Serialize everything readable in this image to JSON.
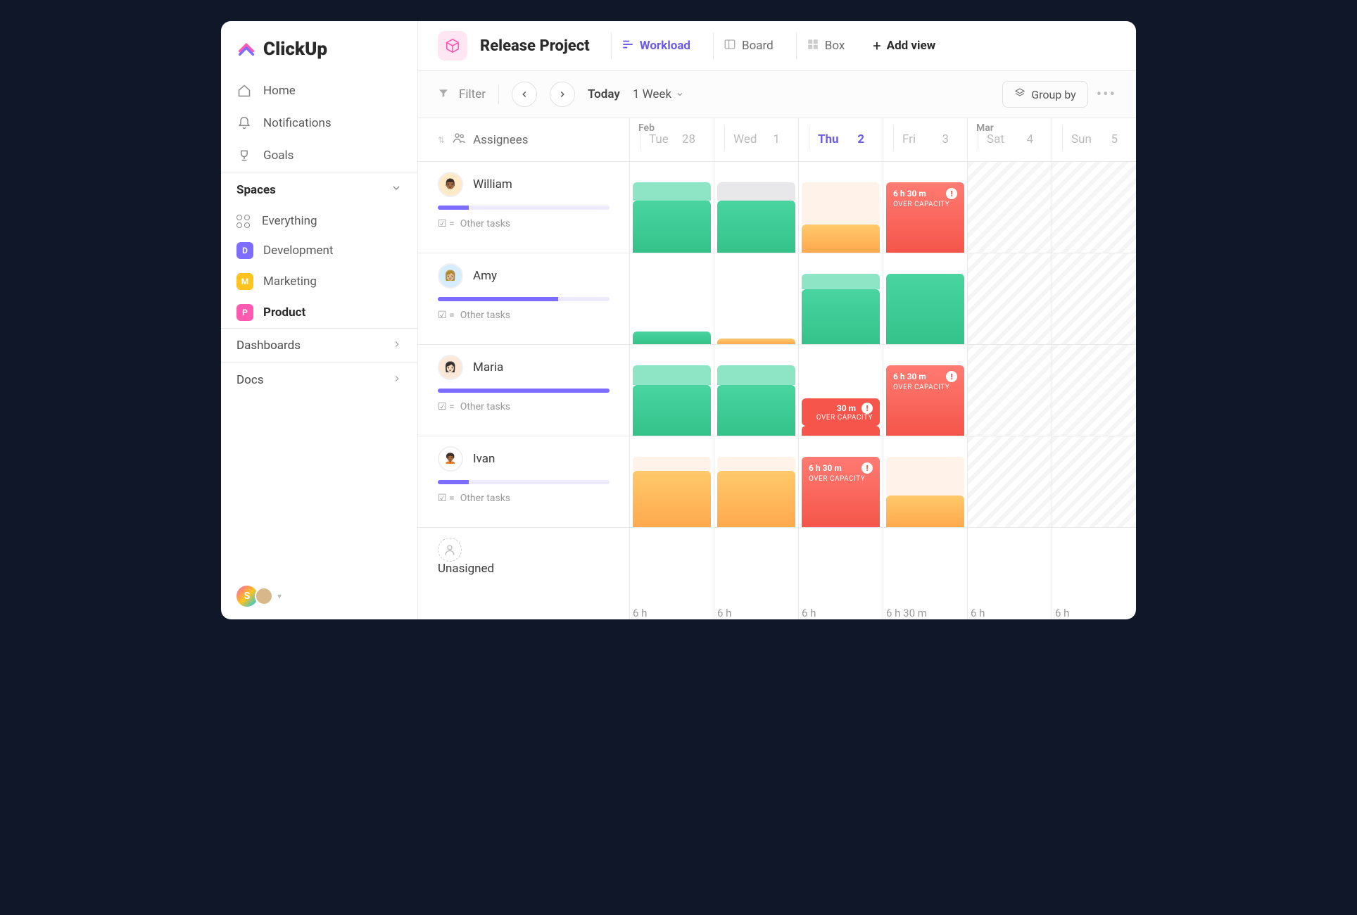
{
  "brand": "ClickUp",
  "nav": {
    "home": "Home",
    "notifications": "Notifications",
    "goals": "Goals"
  },
  "spaces_header": "Spaces",
  "spaces": {
    "everything": "Everything",
    "items": [
      {
        "letter": "D",
        "label": "Development"
      },
      {
        "letter": "M",
        "label": "Marketing"
      },
      {
        "letter": "P",
        "label": "Product"
      }
    ]
  },
  "dashboards": "Dashboards",
  "docs": "Docs",
  "project": {
    "title": "Release Project"
  },
  "views": {
    "workload": "Workload",
    "board": "Board",
    "box": "Box",
    "add": "Add view"
  },
  "toolbar": {
    "filter": "Filter",
    "today": "Today",
    "range": "1 Week",
    "group_by": "Group by"
  },
  "columns": {
    "assignees": "Assignees",
    "month1": "Feb",
    "month2": "Mar",
    "days": [
      {
        "dow": "Tue",
        "num": "28"
      },
      {
        "dow": "Wed",
        "num": "1"
      },
      {
        "dow": "Thu",
        "num": "2",
        "today": true
      },
      {
        "dow": "Fri",
        "num": "3"
      },
      {
        "dow": "Sat",
        "num": "4"
      },
      {
        "dow": "Sun",
        "num": "5"
      }
    ]
  },
  "other_tasks_label": "Other tasks",
  "assignees": [
    {
      "name": "William",
      "progress": 18
    },
    {
      "name": "Amy",
      "progress": 70
    },
    {
      "name": "Maria",
      "progress": 100
    },
    {
      "name": "Ivan",
      "progress": 18
    }
  ],
  "unassigned_label": "Unasigned",
  "overcapacity": {
    "time": "6 h 30 m",
    "label": "OVER CAPACITY"
  },
  "overcapacity_short": {
    "time": "30 m",
    "label": "OVER CAPACITY"
  },
  "footer": [
    "6 h",
    "6 h",
    "6 h",
    "6 h 30 m",
    "6 h",
    "6 h"
  ],
  "user_initial": "S"
}
